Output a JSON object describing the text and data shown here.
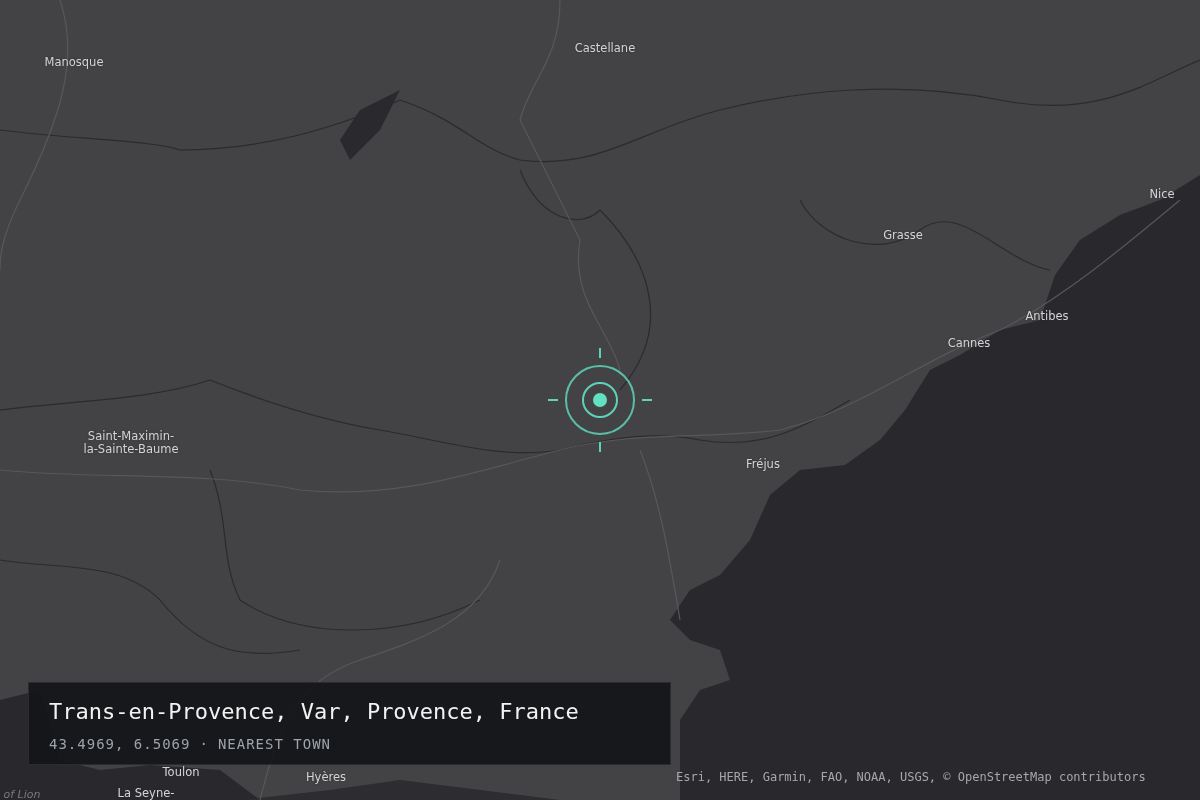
{
  "map": {
    "labels": [
      {
        "name": "Castellane",
        "kind": "town"
      },
      {
        "name": "Manosque",
        "kind": "town"
      },
      {
        "name": "Nice",
        "kind": "town"
      },
      {
        "name": "Grasse",
        "kind": "town"
      },
      {
        "name": "Antibes",
        "kind": "town"
      },
      {
        "name": "Cannes",
        "kind": "town"
      },
      {
        "name": "Saint-Maximin-\nla-Sainte-Baume",
        "kind": "town"
      },
      {
        "name": "Fréjus",
        "kind": "town"
      },
      {
        "name": "Toulon",
        "kind": "town"
      },
      {
        "name": "Hyères",
        "kind": "town"
      },
      {
        "name": "La Seyne-",
        "kind": "town"
      },
      {
        "name": "of Lion",
        "kind": "water"
      }
    ]
  },
  "location_panel": {
    "place": "Trans-en-Provence, Var, Provence, France",
    "coordinates": "43.4969, 6.5069",
    "separator": "·",
    "tag": "NEAREST TOWN"
  },
  "attribution": "Esri, HERE, Garmin, FAO, NOAA, USGS, © OpenStreetMap contributors"
}
